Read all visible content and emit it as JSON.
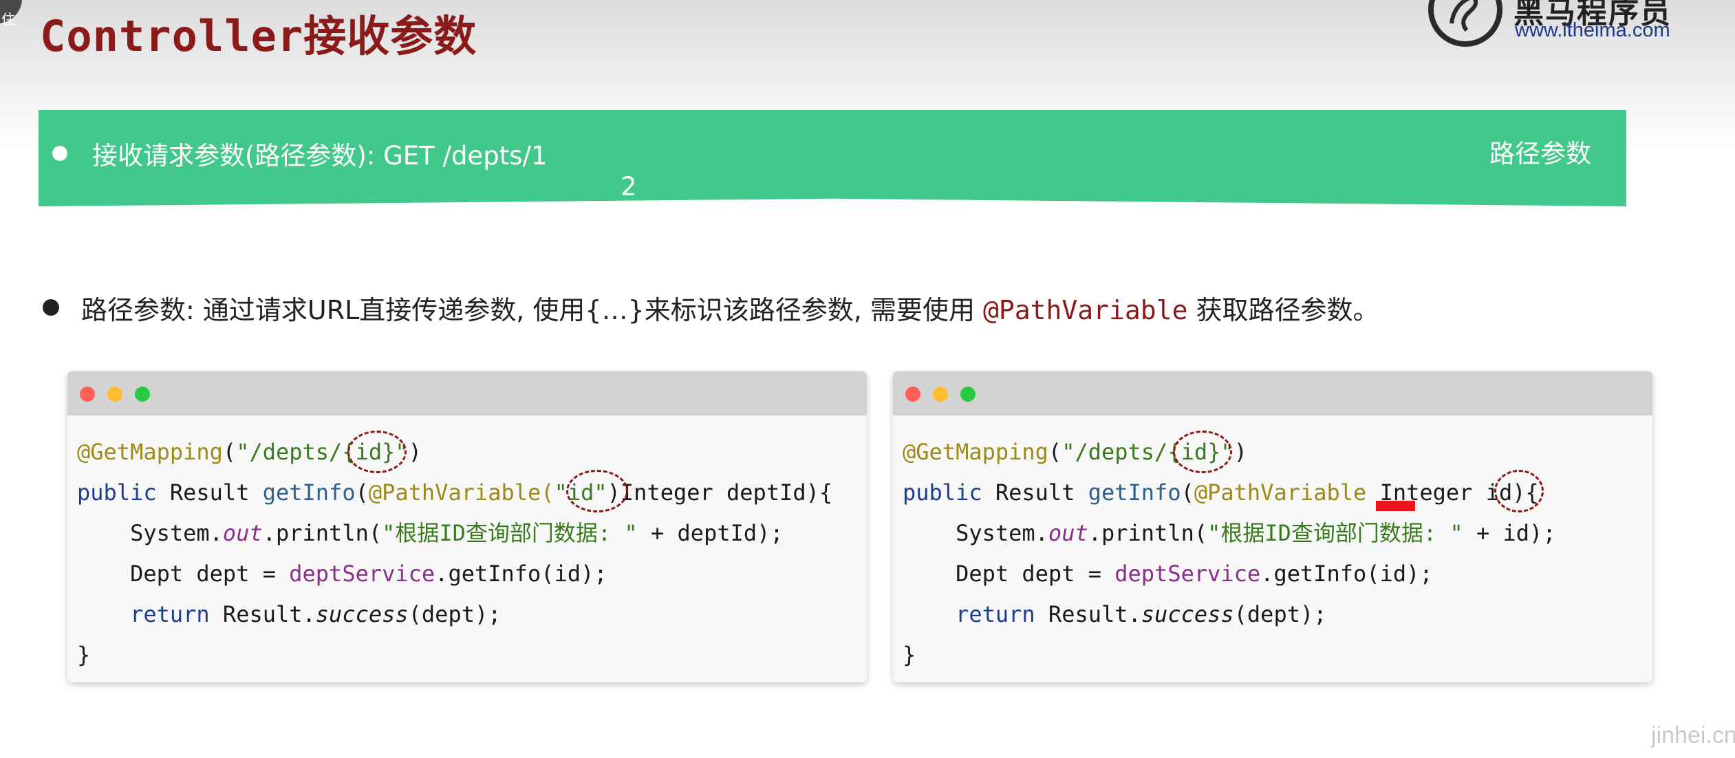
{
  "corner_text": "住",
  "slide_title": "Controller接收参数",
  "logo": {
    "icon": "horse-logo-icon",
    "name": "黑马程序员",
    "url": "www.itheima.com"
  },
  "banner": {
    "text": "接收请求参数(路径参数): GET    /depts/1",
    "line2": "2",
    "right_label": "路径参数"
  },
  "bullet": {
    "prefix": "路径参数: 通过请求URL直接传递参数, 使用{…}来标识该路径参数, 需要使用 ",
    "annotation": "@PathVariable",
    "suffix": " 获取路径参数。"
  },
  "code_left": {
    "l1": {
      "anno": "@GetMapping",
      "open": "(",
      "str_a": "\"/depts/",
      "str_b": "{id}",
      "str_c": "\"",
      "close": ")"
    },
    "l2": {
      "kw": "public",
      "a": " Result ",
      "fn": "getInfo",
      "b": "(",
      "anno": "@PathVariable",
      "c": "(",
      "str": "\"id\"",
      "d": ")Integer deptId){"
    },
    "l3": {
      "indent": "    System.",
      "field": "out",
      "a": ".println(",
      "str": "\"根据ID查询部门数据: \"",
      "b": " + deptId);"
    },
    "l4": {
      "indent": "    Dept dept = ",
      "field": "deptService",
      "a": ".getInfo(id);"
    },
    "l5": {
      "indent": "    ",
      "kw": "return",
      "a": " Result.",
      "ital": "success",
      "b": "(dept);"
    },
    "l6": "}"
  },
  "code_right": {
    "l1": {
      "anno": "@GetMapping",
      "open": "(",
      "str_a": "\"/depts/",
      "str_b": "{id}",
      "str_c": "\"",
      "close": ")"
    },
    "l2": {
      "kw": "public",
      "a": " Result ",
      "fn": "getInfo",
      "b": "(",
      "anno": "@PathVariable",
      "c": " Integer ",
      "d": "id",
      "e": "){"
    },
    "l3": {
      "indent": "    System.",
      "field": "out",
      "a": ".println(",
      "str": "\"根据ID查询部门数据: \"",
      "b": " + id);"
    },
    "l4": {
      "indent": "    Dept dept = ",
      "field": "deptService",
      "a": ".getInfo(id);"
    },
    "l5": {
      "indent": "    ",
      "kw": "return",
      "a": " Result.",
      "ital": "success",
      "b": "(dept);"
    },
    "l6": "}"
  },
  "watermark": "jinhei.cn",
  "colors": {
    "title": "#8b1a1a",
    "banner": "#41c88a",
    "annotation": "#9e8a1a",
    "string": "#3a7a1f",
    "keyword": "#1c3d8f",
    "highlight_circle": "#8b1a1a",
    "red_mark": "#e8141e"
  }
}
